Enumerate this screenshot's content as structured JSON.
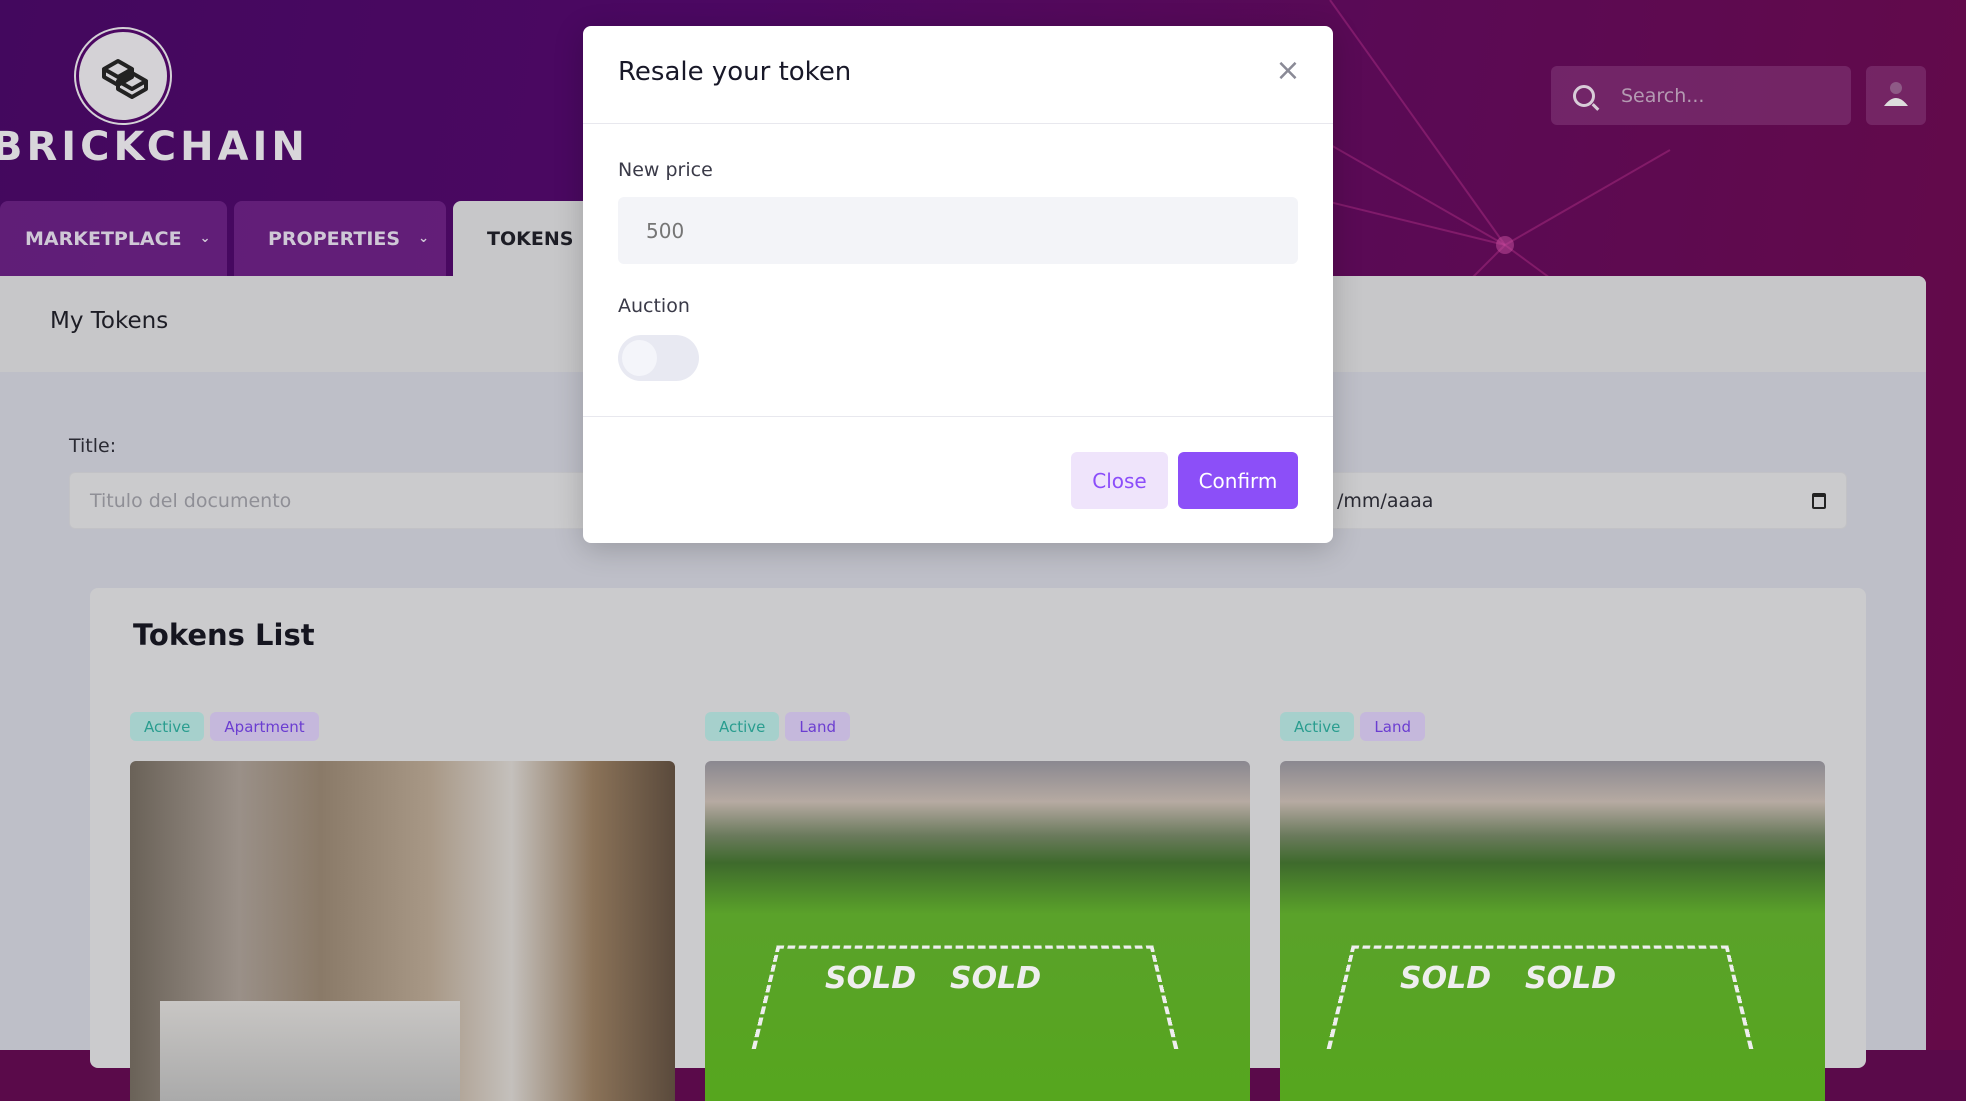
{
  "brand": {
    "name": "BRICKCHAIN",
    "logo": "brickchain-logo"
  },
  "nav": {
    "tabs": [
      {
        "label": "MARKETPLACE",
        "active": false
      },
      {
        "label": "PROPERTIES",
        "active": false
      },
      {
        "label": "TOKENS",
        "active": true
      }
    ]
  },
  "search": {
    "placeholder": "Search...",
    "icon": "search-icon"
  },
  "user": {
    "icon": "user-icon"
  },
  "page": {
    "title": "My Tokens"
  },
  "filters": {
    "title_label": "Title:",
    "title_placeholder": "Titulo del documento",
    "date_placeholder": "/mm/aaaa"
  },
  "tokens_list": {
    "title": "Tokens List",
    "cards": [
      {
        "status": "Active",
        "type": "Apartment",
        "image": "bedroom-interior"
      },
      {
        "status": "Active",
        "type": "Land",
        "image": "green-field-sold-plots"
      },
      {
        "status": "Active",
        "type": "Land",
        "image": "green-field-sold-plots"
      }
    ],
    "image_text": "SOLD"
  },
  "modal": {
    "title": "Resale your token",
    "price_label": "New price",
    "price_placeholder": "500",
    "auction_label": "Auction",
    "auction_on": false,
    "close_label": "Close",
    "confirm_label": "Confirm"
  },
  "colors": {
    "accent": "#8c4ff8",
    "header": "#4c0862",
    "badge_active": "#2a9d8f",
    "badge_type": "#6b3dd1"
  }
}
